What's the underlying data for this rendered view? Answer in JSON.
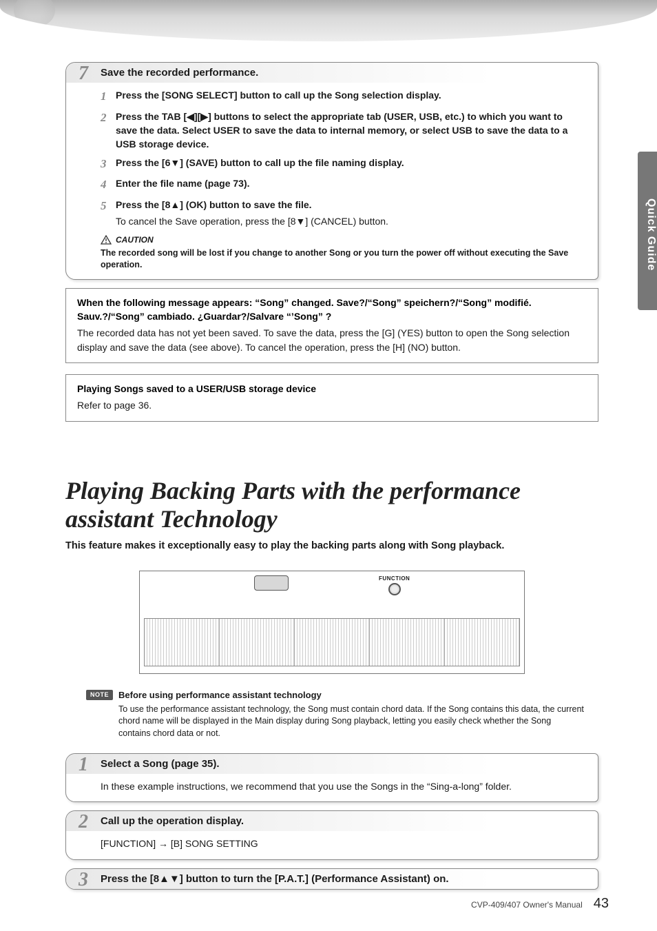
{
  "side_tab": "Quick Guide",
  "step7": {
    "num": "7",
    "title": "Save the recorded performance.",
    "sub1": {
      "n": "1",
      "t": "Press the [SONG SELECT] button to call up the Song selection display."
    },
    "sub2": {
      "n": "2",
      "t": "Press the TAB [◀][▶] buttons to select the appropriate tab (USER, USB, etc.) to which you want to save the data. Select USER to save the data to internal memory, or select USB to save the data to a USB storage device."
    },
    "sub3": {
      "n": "3",
      "t": "Press the [6▼] (SAVE) button to call up the file naming display."
    },
    "sub4": {
      "n": "4",
      "t": "Enter the file name (page 73)."
    },
    "sub5": {
      "n": "5",
      "t": "Press the [8▲] (OK) button to save the file."
    },
    "sub5_extra": "To cancel the Save operation, press the [8▼] (CANCEL) button.",
    "caution_label": "CAUTION",
    "caution_text": "The recorded song will be lost if you change to another Song or you turn the power off without executing the Save operation."
  },
  "msgbox": {
    "title": "When the following message appears: “Song” changed. Save?/“Song” speichern?/“Song” modifié. Sauv.?/“Song” cambiado. ¿Guardar?/Salvare “’Song” ?",
    "body": "The recorded data has not yet been saved. To save the data, press the [G] (YES) button to open the Song selection display and save the data (see above). To cancel the operation, press the [H] (NO) button."
  },
  "playbox": {
    "title": "Playing Songs saved to a USER/USB storage device",
    "body": "Refer to page 36."
  },
  "section": {
    "title": "Playing Backing Parts with the performance assistant Technology",
    "sub": "This feature makes it exceptionally easy to play the backing parts along with Song playback."
  },
  "function_label": "FUNCTION",
  "note": {
    "badge": "NOTE",
    "title": "Before using performance assistant technology",
    "body": "To use the performance assistant technology, the Song must contain chord data. If the Song contains this data, the current chord name will be displayed in the Main display during Song playback, letting you easily check whether the Song contains chord data or not."
  },
  "step1": {
    "num": "1",
    "title": "Select a Song (page 35).",
    "body": "In these example instructions, we recommend that you use the Songs in the “Sing-a-long” folder."
  },
  "step2": {
    "num": "2",
    "title": "Call up the operation display.",
    "body": "[FUNCTION]  → [B] SONG SETTING"
  },
  "step3": {
    "num": "3",
    "title": "Press the [8▲▼] button to turn the [P.A.T.] (Performance Assistant) on."
  },
  "footer": {
    "doc": "CVP-409/407 Owner's Manual",
    "page": "43"
  }
}
